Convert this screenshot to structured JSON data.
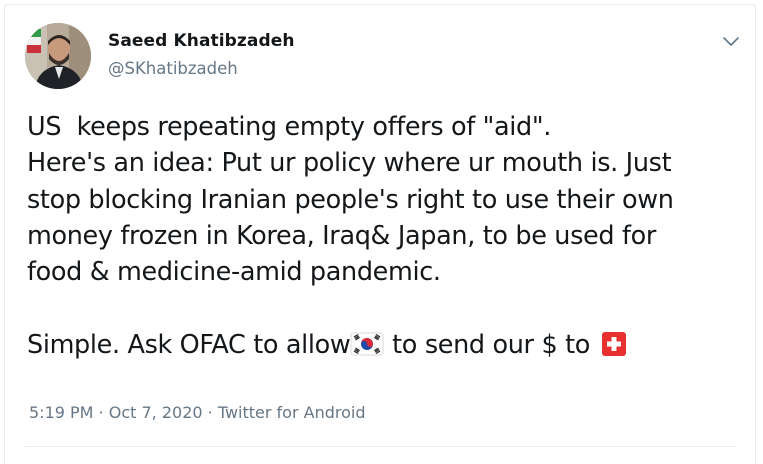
{
  "author": {
    "name": "Saeed Khatibzadeh",
    "handle": "@SKhatibzadeh"
  },
  "tweet": {
    "lines": [
      "US  keeps repeating empty offers of \"aid\".",
      "Here's an idea: Put ur policy where ur mouth is. Just",
      "stop blocking Iranian people's right to use their own",
      "money frozen in Korea, Iraq& Japan, to be used for",
      "food & medicine-amid pandemic.",
      ""
    ],
    "last_line": {
      "part1": "Simple. Ask OFAC to allow",
      "part2": " to send our $ to "
    },
    "emoji_1": "south-korea-flag-icon",
    "emoji_2": "swiss-flag-icon"
  },
  "meta": {
    "time": "5:19 PM",
    "separator": " · ",
    "date": "Oct 7, 2020",
    "source": "Twitter for Android"
  },
  "colors": {
    "text": "#14171a",
    "secondary": "#657786",
    "border": "#e6ecf0",
    "swiss_red": "#e8312f"
  }
}
